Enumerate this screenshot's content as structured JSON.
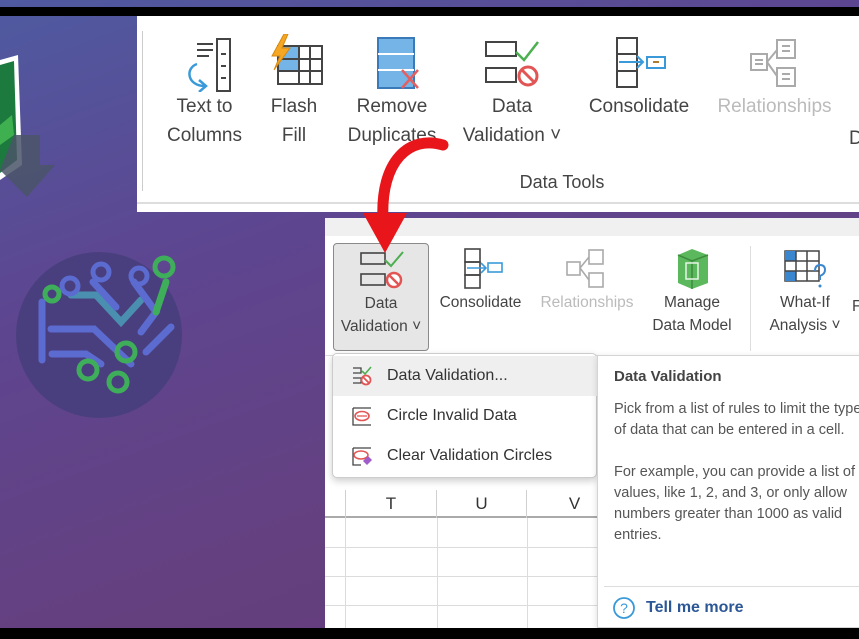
{
  "top_ribbon": {
    "buttons": [
      {
        "label_1": "Text to",
        "label_2": "Columns",
        "icon": "text-to-columns-icon"
      },
      {
        "label_1": "Flash",
        "label_2": "Fill",
        "icon": "flash-fill-icon"
      },
      {
        "label_1": "Remove",
        "label_2": "Duplicates",
        "icon": "remove-duplicates-icon"
      },
      {
        "label_1": "Data",
        "label_2": "Validation ˅",
        "icon": "data-validation-icon"
      },
      {
        "label_1": "Consolidate",
        "icon": "consolidate-icon"
      },
      {
        "label_1": "Relationships",
        "icon": "relationships-icon",
        "disabled": true
      }
    ],
    "cut_label": "D",
    "group_label": "Data Tools"
  },
  "second_ribbon": {
    "buttons": [
      {
        "label_1": "Data",
        "label_2": "Validation ˅",
        "icon": "data-validation-icon",
        "active": true
      },
      {
        "label_1": "Consolidate",
        "icon": "consolidate-icon"
      },
      {
        "label_1": "Relationships",
        "icon": "relationships-icon",
        "disabled": true
      },
      {
        "label_1": "Manage",
        "label_2": "Data Model",
        "icon": "manage-data-model-icon"
      },
      {
        "label_1": "What-If",
        "label_2": "Analysis ˅",
        "icon": "what-if-analysis-icon"
      }
    ],
    "cut_label": "F"
  },
  "dropdown_menu": {
    "items": [
      {
        "label": "Data Validation...",
        "icon": "data-validation-icon",
        "hovered": true
      },
      {
        "label": "Circle Invalid Data",
        "icon": "circle-invalid-data-icon"
      },
      {
        "label": "Clear Validation Circles",
        "icon": "clear-validation-circles-icon"
      }
    ]
  },
  "spreadsheet": {
    "columns": [
      "T",
      "U",
      "V"
    ]
  },
  "tooltip": {
    "title": "Data Validation",
    "paragraph_1": "Pick from a list of rules to limit the type of data that can be entered in a cell.",
    "paragraph_2": "For example, you can provide a list of values, like 1, 2, and 3, or only allow numbers greater than 1000 as valid entries.",
    "link": "Tell me more"
  },
  "colors": {
    "accent_arrow": "#e8151b",
    "link": "#2b5797",
    "excel_green": "#1d7a3e"
  }
}
